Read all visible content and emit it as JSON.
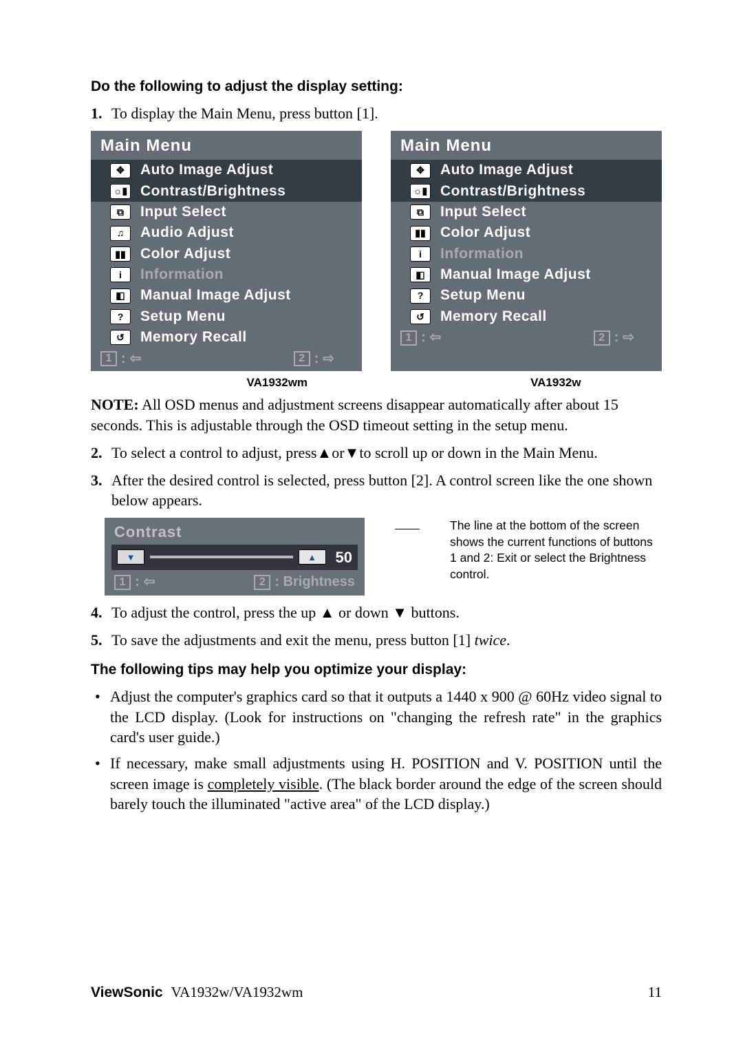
{
  "heading_adjust": "Do the following to adjust the display setting:",
  "step1": {
    "num": "1.",
    "text": "To display the Main Menu, press button [1]."
  },
  "osd_left": {
    "title": "Main Menu",
    "items": [
      {
        "icon": "✥",
        "label": "Auto Image Adjust",
        "lit": true,
        "selected": true
      },
      {
        "icon": "☼▮",
        "label": "Contrast/Brightness",
        "lit": true,
        "selected": true
      },
      {
        "icon": "⧉",
        "label": "Input Select",
        "lit": true,
        "selected": false
      },
      {
        "icon": "♫",
        "label": "Audio Adjust",
        "lit": true,
        "selected": false
      },
      {
        "icon": "▮▮",
        "label": "Color Adjust",
        "lit": true,
        "selected": false
      },
      {
        "icon": "i",
        "label": "Information",
        "lit": false,
        "selected": false
      },
      {
        "icon": "◧",
        "label": "Manual Image Adjust",
        "lit": true,
        "selected": false
      },
      {
        "icon": "?",
        "label": "Setup Menu",
        "lit": true,
        "selected": false
      },
      {
        "icon": "↺",
        "label": "Memory Recall",
        "lit": true,
        "selected": false
      }
    ],
    "footer1": "1",
    "footer2": "2"
  },
  "osd_right": {
    "title": "Main Menu",
    "items": [
      {
        "icon": "✥",
        "label": "Auto Image Adjust",
        "lit": true,
        "selected": true
      },
      {
        "icon": "☼▮",
        "label": "Contrast/Brightness",
        "lit": true,
        "selected": true
      },
      {
        "icon": "⧉",
        "label": "Input Select",
        "lit": true,
        "selected": false
      },
      {
        "icon": "▮▮",
        "label": "Color Adjust",
        "lit": true,
        "selected": false
      },
      {
        "icon": "i",
        "label": "Information",
        "lit": false,
        "selected": false
      },
      {
        "icon": "◧",
        "label": "Manual Image Adjust",
        "lit": true,
        "selected": false
      },
      {
        "icon": "?",
        "label": "Setup Menu",
        "lit": true,
        "selected": false
      },
      {
        "icon": "↺",
        "label": "Memory Recall",
        "lit": true,
        "selected": false
      }
    ],
    "footer1": "1",
    "footer2": "2"
  },
  "model_left": "VA1932wm",
  "model_right": "VA1932w",
  "note_label": "NOTE:",
  "note_text": " All OSD menus and adjustment screens disappear automatically after about 15 seconds. This is adjustable through the OSD timeout setting in the setup menu.",
  "step2": {
    "num": "2.",
    "pre": "To select a control to adjust, press",
    "mid": "or",
    "post": "to scroll up or down in the Main Menu."
  },
  "step3": {
    "num": "3.",
    "text": "After the desired control is selected, press button [2]. A control screen like the one shown below appears."
  },
  "contrast": {
    "title": "Contrast",
    "value": "50",
    "footer1": "1",
    "footer2_label": ": Brightness",
    "footer2_num": "2"
  },
  "contrast_note": "The line at the bottom of the screen shows the current functions of buttons 1 and 2: Exit or select the Brightness control.",
  "step4": {
    "num": "4.",
    "pre": "To adjust the control, press the up ",
    "mid": " or down ",
    "post": " buttons."
  },
  "step5": {
    "num": "5.",
    "pre": "To save the adjustments and exit the menu, press button [1] ",
    "twice": "twice",
    "post": "."
  },
  "heading_tips": "The following tips may help you optimize your display:",
  "tip1": "Adjust the computer's graphics card so that it outputs a 1440 x 900 @ 60Hz video signal to the LCD display. (Look for instructions on \"changing the refresh rate\" in the graphics card's user guide.)",
  "tip2_pre": "If necessary, make small adjustments using H. POSITION and V. POSITION until the screen image is ",
  "tip2_underline": "completely visible",
  "tip2_post": ". (The black border around the edge of the screen should barely touch the illuminated \"active area\" of the LCD display.)",
  "footer_brand": "ViewSonic",
  "footer_model": "VA1932w/VA1932wm",
  "footer_page": "11"
}
